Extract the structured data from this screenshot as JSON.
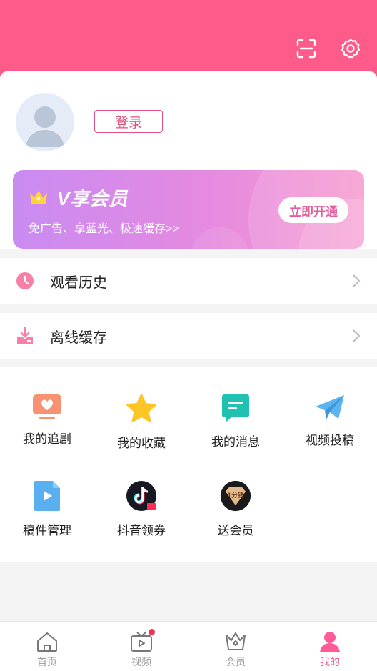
{
  "header": {
    "bg_color": "#fe5a8a",
    "scan_icon": "scan-icon",
    "settings_icon": "gear-icon"
  },
  "profile": {
    "avatar_icon": "default-avatar",
    "login_label": "登录"
  },
  "vip_banner": {
    "title": "V享会员",
    "subtitle": "免广告、享蓝光、极速缓存>>",
    "button_label": "立即开通",
    "icon": "crown-icon"
  },
  "list": [
    {
      "label": "观看历史",
      "icon": "clock-icon"
    },
    {
      "label": "离线缓存",
      "icon": "download-icon"
    }
  ],
  "grid": [
    {
      "label": "我的追剧",
      "icon": "tv-heart-icon"
    },
    {
      "label": "我的收藏",
      "icon": "star-icon"
    },
    {
      "label": "我的消息",
      "icon": "message-icon"
    },
    {
      "label": "视频投稿",
      "icon": "paper-plane-icon"
    },
    {
      "label": "稿件管理",
      "icon": "video-file-icon"
    },
    {
      "label": "抖音领券",
      "icon": "douyin-icon"
    },
    {
      "label": "送会员",
      "icon": "one-fen-icon",
      "badge_text": "1分钱"
    }
  ],
  "tabbar": [
    {
      "label": "首页",
      "icon": "home-icon"
    },
    {
      "label": "视频",
      "icon": "video-tv-icon",
      "has_dot": true
    },
    {
      "label": "会员",
      "icon": "crown-outline-icon"
    },
    {
      "label": "我的",
      "icon": "user-icon",
      "active": true
    }
  ],
  "colors": {
    "accent": "#ff5b9a",
    "login_border": "#e0507d"
  }
}
